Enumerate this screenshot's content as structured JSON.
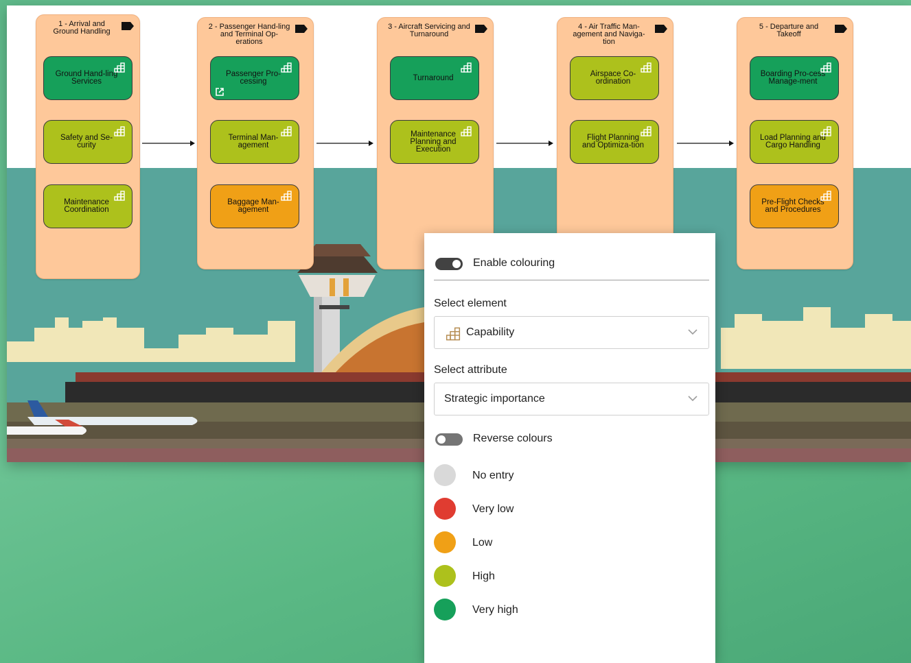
{
  "stages": [
    {
      "title": "1 - Arrival and Ground Handling",
      "capabilities": [
        {
          "label": "Ground Hand-ling Services",
          "importance": "Very high"
        },
        {
          "label": "Safety and Se-curity",
          "importance": "High"
        },
        {
          "label": "Maintenance Coordination",
          "importance": "High"
        }
      ]
    },
    {
      "title": "2 - Passenger Hand-ling and Terminal Op-erations",
      "capabilities": [
        {
          "label": "Passenger Pro-cessing",
          "importance": "Very high",
          "has_link": true
        },
        {
          "label": "Terminal Man-agement",
          "importance": "High"
        },
        {
          "label": "Baggage Man-agement",
          "importance": "Low"
        }
      ]
    },
    {
      "title": "3 - Aircraft Servicing and Turnaround",
      "capabilities": [
        {
          "label": "Turnaround",
          "importance": "Very high"
        },
        {
          "label": "Maintenance Planning and Execution",
          "importance": "High"
        }
      ]
    },
    {
      "title": "4 - Air Traffic Man-agement and Naviga-tion",
      "capabilities": [
        {
          "label": "Airspace Co-ordination",
          "importance": "High"
        },
        {
          "label": "Flight Planning and Optimiza-tion",
          "importance": "High"
        }
      ]
    },
    {
      "title": "5 - Departure and Takeoff",
      "capabilities": [
        {
          "label": "Boarding Pro-cess Manage-ment",
          "importance": "Very high"
        },
        {
          "label": "Load Planning and Cargo Handling",
          "importance": "High"
        },
        {
          "label": "Pre-Flight Checks and Procedures",
          "importance": "Low"
        }
      ]
    }
  ],
  "panel": {
    "enable_colouring_label": "Enable colouring",
    "enable_colouring_on": true,
    "select_element_label": "Select element",
    "select_element_value": "Capability",
    "select_attribute_label": "Select attribute",
    "select_attribute_value": "Strategic importance",
    "reverse_colours_label": "Reverse colours",
    "reverse_colours_on": false,
    "legend": [
      {
        "label": "No entry",
        "color": "#d9d9d9"
      },
      {
        "label": "Very low",
        "color": "#e03c31"
      },
      {
        "label": "Low",
        "color": "#f0a016"
      },
      {
        "label": "High",
        "color": "#adc11c"
      },
      {
        "label": "Very high",
        "color": "#16a05a"
      }
    ]
  },
  "icons": {
    "capability": "capability-icon",
    "stage_flag": "value-stream-flag-icon",
    "external_link": "external-link-icon",
    "chevron": "chevron-down-icon"
  }
}
